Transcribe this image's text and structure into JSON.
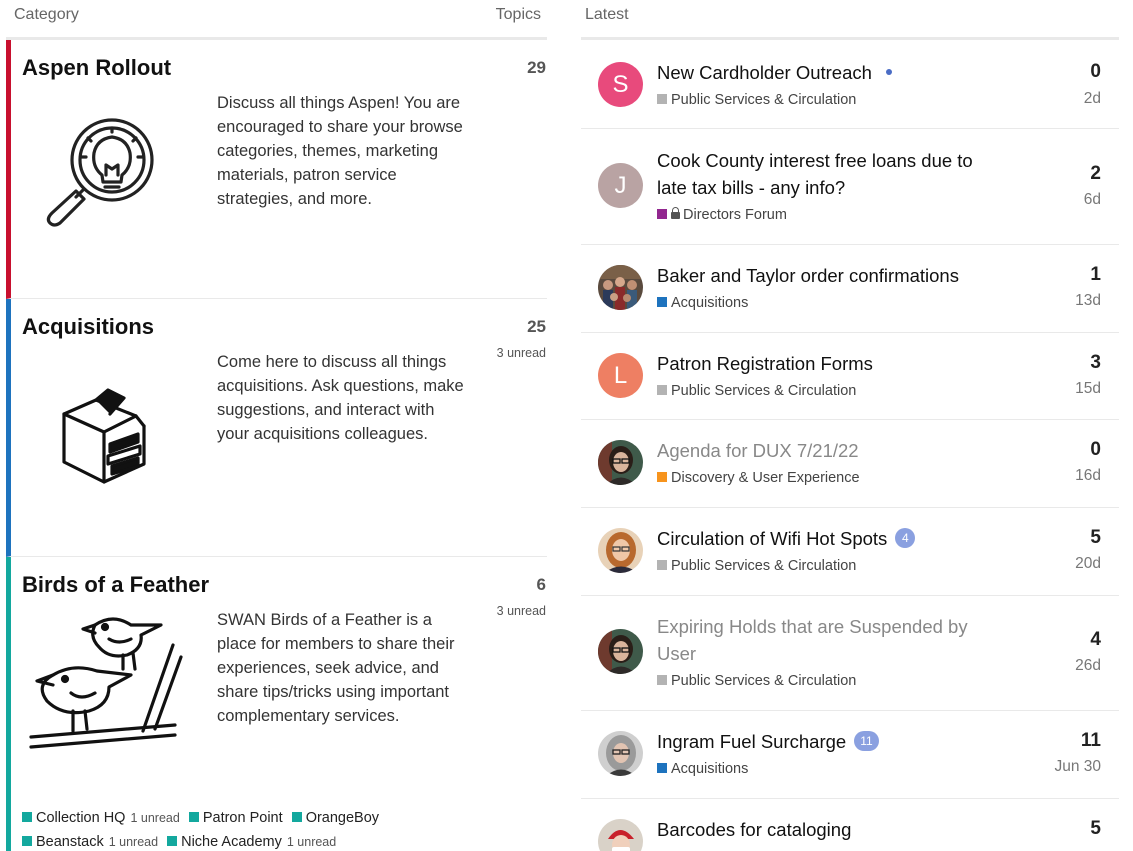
{
  "categories_header": {
    "label": "Category",
    "topics_label": "Topics"
  },
  "latest_header": {
    "label": "Latest"
  },
  "categories": [
    {
      "title": "Aspen Rollout",
      "count": "29",
      "unread": "",
      "color": "#c8102e",
      "icon": "lightbulb-magnifier-icon",
      "description": "Discuss all things Aspen! You are encouraged to share your browse categories, themes, marketing materials, patron service strategies, and more."
    },
    {
      "title": "Acquisitions",
      "count": "25",
      "unread": "3 unread",
      "color": "#1e73be",
      "icon": "box-of-books-icon",
      "description": "Come here to discuss all things acquisitions. Ask questions, make suggestions, and interact with your acquisitions colleagues."
    },
    {
      "title": "Birds of a Feather",
      "count": "6",
      "unread": "3 unread",
      "color": "#13a89e",
      "icon": "birds-on-branch-icon",
      "description": "SWAN Birds of a Feather is a place for members to share their experiences, seek advice, and share tips/tricks using important complementary services.",
      "subcategories": [
        {
          "name": "Collection HQ",
          "unread": "1 unread",
          "color": "#13a89e"
        },
        {
          "name": "Patron Point",
          "unread": "",
          "color": "#13a89e"
        },
        {
          "name": "OrangeBoy",
          "unread": "",
          "color": "#13a89e"
        },
        {
          "name": "Beanstack",
          "unread": "1 unread",
          "color": "#13a89e"
        },
        {
          "name": "Niche Academy",
          "unread": "1 unread",
          "color": "#13a89e"
        }
      ]
    }
  ],
  "topics": [
    {
      "title": "New Cardholder Outreach",
      "category": "Public Services & Circulation",
      "cat_color": "#b3b3b3",
      "replies": "0",
      "age": "2d",
      "avatar_letter": "S",
      "avatar_color": "#e84a7c",
      "new": true
    },
    {
      "title": "Cook County interest free loans due to late tax bills - any info?",
      "category": "Directors Forum",
      "cat_color": "#92278f",
      "replies": "2",
      "age": "6d",
      "avatar_letter": "J",
      "avatar_color": "#b9a3a3",
      "locked": true
    },
    {
      "title": "Baker and Taylor order confirmations",
      "category": "Acquisitions",
      "cat_color": "#1e73be",
      "replies": "1",
      "age": "13d",
      "avatar": "group-photo-avatar"
    },
    {
      "title": "Patron Registration Forms",
      "category": "Public Services & Circulation",
      "cat_color": "#b3b3b3",
      "replies": "3",
      "age": "15d",
      "avatar_letter": "L",
      "avatar_color": "#ee7f63"
    },
    {
      "title": "Agenda for DUX 7/21/22",
      "category": "Discovery & User Experience",
      "cat_color": "#f7941d",
      "replies": "0",
      "age": "16d",
      "avatar": "woman-glasses-avatar",
      "visited": true
    },
    {
      "title": "Circulation of Wifi Hot Spots",
      "category": "Public Services & Circulation",
      "cat_color": "#b3b3b3",
      "replies": "5",
      "age": "20d",
      "avatar": "woman-red-hair-avatar",
      "badge": "4"
    },
    {
      "title": "Expiring Holds that are Suspended by User",
      "category": "Public Services & Circulation",
      "cat_color": "#b3b3b3",
      "replies": "4",
      "age": "26d",
      "avatar": "woman-glasses-avatar",
      "visited": true
    },
    {
      "title": "Ingram Fuel Surcharge",
      "category": "Acquisitions",
      "cat_color": "#1e73be",
      "replies": "11",
      "age": "Jun 30",
      "avatar": "woman-gray-hair-avatar",
      "badge": "11"
    },
    {
      "title": "Barcodes for cataloging",
      "category": "",
      "cat_color": "#b3b3b3",
      "replies": "5",
      "age": "",
      "avatar": "person-red-hat-avatar"
    }
  ]
}
